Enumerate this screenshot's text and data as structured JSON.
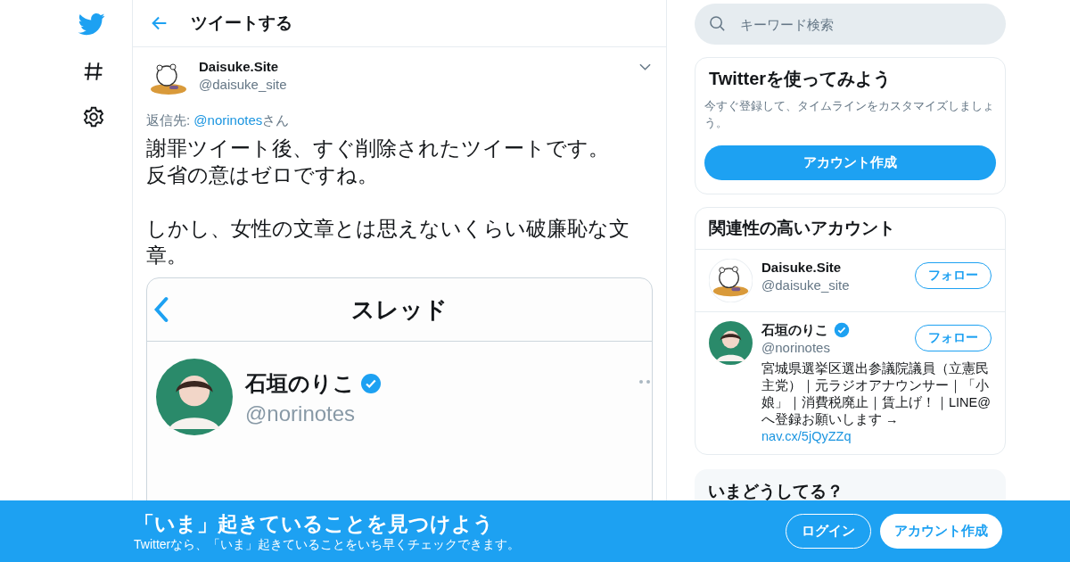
{
  "header": {
    "title": "ツイートする"
  },
  "tweet": {
    "name": "Daisuke.Site",
    "handle": "@daisuke_site",
    "reply_label": "返信先: ",
    "reply_to": "@norinotes",
    "reply_suffix": "さん",
    "paragraphs": [
      {
        "lines": [
          "謝罪ツイート後、すぐ削除されたツイートです。",
          "反省の意はゼロですね。"
        ]
      },
      {
        "lines": [
          "しかし、女性の文章とは思えないくらい破廉恥な文章。"
        ]
      }
    ],
    "embedded": {
      "title": "スレッド",
      "name": "石垣のりこ",
      "verified": true,
      "handle": "@norinotes"
    }
  },
  "search": {
    "placeholder": "キーワード検索"
  },
  "signup_card": {
    "title": "Twitterを使ってみよう",
    "text": "今すぐ登録して、タイムラインをカスタマイズしましょう。",
    "button": "アカウント作成"
  },
  "related": {
    "title": "関連性の高いアカウント",
    "accounts": [
      {
        "name": "Daisuke.Site",
        "handle": "@daisuke_site",
        "verified": false,
        "follow": "フォロー"
      },
      {
        "name": "石垣のりこ",
        "handle": "@norinotes",
        "verified": true,
        "follow": "フォロー",
        "bio": "宮城県選挙区選出参議院議員（立憲民主党）｜元ラジオアナウンサー｜「小娘」｜消費税廃止｜賃上げ！｜LINE@へ登録お願いします →",
        "link": "nav.cx/5jQyZZq"
      }
    ]
  },
  "trends": {
    "title": "いまどうしてる？"
  },
  "banner": {
    "title": "「いま」起きていることを見つけよう",
    "subtitle": "Twitterなら、「いま」起きていることをいち早くチェックできます。",
    "login": "ログイン",
    "signup": "アカウント作成"
  }
}
